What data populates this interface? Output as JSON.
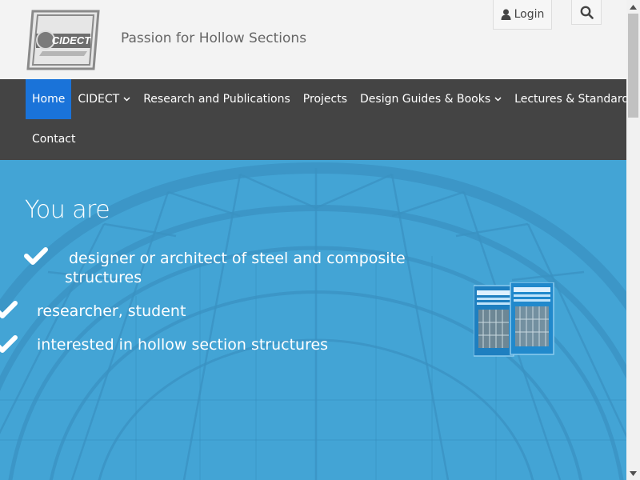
{
  "header": {
    "logo_text": "CIDECT",
    "tagline": "Passion for Hollow Sections",
    "login_label": "Login"
  },
  "nav": {
    "items": [
      {
        "label": "Home",
        "active": true,
        "dropdown": false
      },
      {
        "label": "CIDECT",
        "active": false,
        "dropdown": true
      },
      {
        "label": "Research and Publications",
        "active": false,
        "dropdown": false
      },
      {
        "label": "Projects",
        "active": false,
        "dropdown": false
      },
      {
        "label": "Design Guides & Books",
        "active": false,
        "dropdown": true
      },
      {
        "label": "Lectures & Standards",
        "active": false,
        "dropdown": true
      },
      {
        "label": "Contact",
        "active": false,
        "dropdown": false
      }
    ]
  },
  "hero": {
    "title": "You are",
    "items": [
      {
        "line1": "designer or architect of steel and composite",
        "line2": "structures"
      },
      {
        "line1": "researcher, student"
      },
      {
        "line1": "interested in hollow section structures"
      }
    ]
  },
  "colors": {
    "nav_bg": "#444444",
    "active": "#1a73d9",
    "hero_bg": "#43a4d5"
  }
}
